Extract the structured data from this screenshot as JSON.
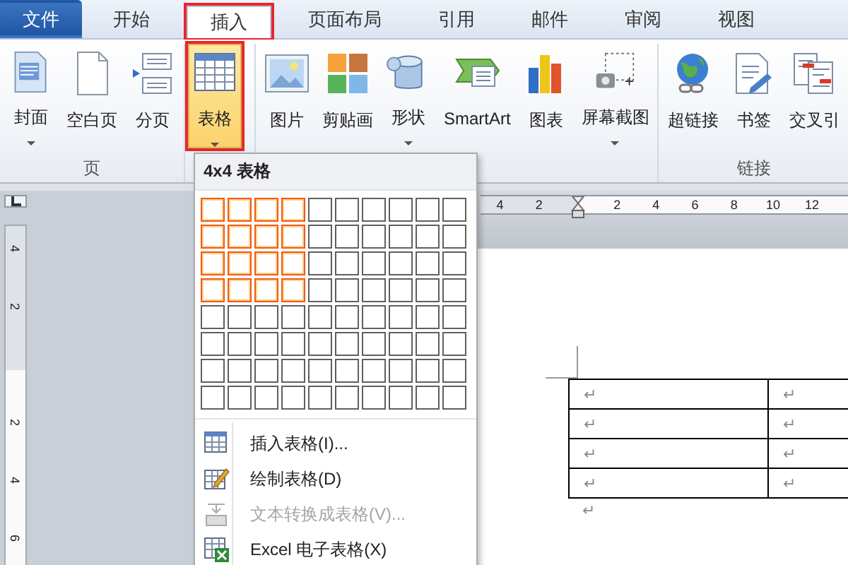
{
  "tabs": [
    {
      "label": "文件",
      "kind": "file",
      "selected": false,
      "marked": false
    },
    {
      "label": "开始",
      "kind": "tab",
      "selected": false,
      "marked": false
    },
    {
      "label": "插入",
      "kind": "tab",
      "selected": true,
      "marked": true
    },
    {
      "label": "页面布局",
      "kind": "tab",
      "selected": false,
      "marked": false
    },
    {
      "label": "引用",
      "kind": "tab",
      "selected": false,
      "marked": false
    },
    {
      "label": "邮件",
      "kind": "tab",
      "selected": false,
      "marked": false
    },
    {
      "label": "审阅",
      "kind": "tab",
      "selected": false,
      "marked": false
    },
    {
      "label": "视图",
      "kind": "tab",
      "selected": false,
      "marked": false
    }
  ],
  "ribbon": {
    "groups": [
      {
        "label": "页",
        "buttons": [
          {
            "label": "封面",
            "kind": "cover",
            "dropdown": true,
            "selected": false,
            "marked": false
          },
          {
            "label": "空白页",
            "kind": "blank",
            "dropdown": false,
            "selected": false,
            "marked": false
          },
          {
            "label": "分页",
            "kind": "pagebreak",
            "dropdown": false,
            "selected": false,
            "marked": false
          }
        ]
      },
      {
        "buttons": [
          {
            "label": "表格",
            "kind": "table",
            "dropdown": true,
            "selected": true,
            "marked": true
          }
        ]
      },
      {
        "buttons": [
          {
            "label": "图片",
            "kind": "picture",
            "dropdown": false,
            "selected": false,
            "marked": false
          },
          {
            "label": "剪贴画",
            "kind": "clipart",
            "dropdown": false,
            "selected": false,
            "marked": false
          },
          {
            "label": "形状",
            "kind": "shapes",
            "dropdown": true,
            "selected": false,
            "marked": false
          },
          {
            "label": "SmartArt",
            "kind": "smartart",
            "dropdown": false,
            "selected": false,
            "marked": false
          },
          {
            "label": "图表",
            "kind": "chart",
            "dropdown": false,
            "selected": false,
            "marked": false
          },
          {
            "label": "屏幕截图",
            "kind": "screenshot",
            "dropdown": true,
            "selected": false,
            "marked": false
          }
        ]
      },
      {
        "label": "链接",
        "buttons": [
          {
            "label": "超链接",
            "kind": "hyperlink",
            "dropdown": false,
            "selected": false,
            "marked": false
          },
          {
            "label": "书签",
            "kind": "bookmark",
            "dropdown": false,
            "selected": false,
            "marked": false
          },
          {
            "label": "交叉引",
            "kind": "crossref",
            "dropdown": false,
            "selected": false,
            "marked": false
          }
        ]
      }
    ]
  },
  "table_menu": {
    "title": "4x4 表格",
    "grid": [
      {
        "cells": [
          {
            "selected": true
          },
          {
            "selected": true
          },
          {
            "selected": true
          },
          {
            "selected": true
          },
          {
            "selected": false
          },
          {
            "selected": false
          },
          {
            "selected": false
          },
          {
            "selected": false
          },
          {
            "selected": false
          },
          {
            "selected": false
          }
        ]
      },
      {
        "cells": [
          {
            "selected": true
          },
          {
            "selected": true
          },
          {
            "selected": true
          },
          {
            "selected": true
          },
          {
            "selected": false
          },
          {
            "selected": false
          },
          {
            "selected": false
          },
          {
            "selected": false
          },
          {
            "selected": false
          },
          {
            "selected": false
          }
        ]
      },
      {
        "cells": [
          {
            "selected": true
          },
          {
            "selected": true
          },
          {
            "selected": true
          },
          {
            "selected": true
          },
          {
            "selected": false
          },
          {
            "selected": false
          },
          {
            "selected": false
          },
          {
            "selected": false
          },
          {
            "selected": false
          },
          {
            "selected": false
          }
        ]
      },
      {
        "cells": [
          {
            "selected": true
          },
          {
            "selected": true
          },
          {
            "selected": true
          },
          {
            "selected": true
          },
          {
            "selected": false
          },
          {
            "selected": false
          },
          {
            "selected": false
          },
          {
            "selected": false
          },
          {
            "selected": false
          },
          {
            "selected": false
          }
        ]
      },
      {
        "cells": [
          {
            "selected": false
          },
          {
            "selected": false
          },
          {
            "selected": false
          },
          {
            "selected": false
          },
          {
            "selected": false
          },
          {
            "selected": false
          },
          {
            "selected": false
          },
          {
            "selected": false
          },
          {
            "selected": false
          },
          {
            "selected": false
          }
        ]
      },
      {
        "cells": [
          {
            "selected": false
          },
          {
            "selected": false
          },
          {
            "selected": false
          },
          {
            "selected": false
          },
          {
            "selected": false
          },
          {
            "selected": false
          },
          {
            "selected": false
          },
          {
            "selected": false
          },
          {
            "selected": false
          },
          {
            "selected": false
          }
        ]
      },
      {
        "cells": [
          {
            "selected": false
          },
          {
            "selected": false
          },
          {
            "selected": false
          },
          {
            "selected": false
          },
          {
            "selected": false
          },
          {
            "selected": false
          },
          {
            "selected": false
          },
          {
            "selected": false
          },
          {
            "selected": false
          },
          {
            "selected": false
          }
        ]
      },
      {
        "cells": [
          {
            "selected": false
          },
          {
            "selected": false
          },
          {
            "selected": false
          },
          {
            "selected": false
          },
          {
            "selected": false
          },
          {
            "selected": false
          },
          {
            "selected": false
          },
          {
            "selected": false
          },
          {
            "selected": false
          },
          {
            "selected": false
          }
        ]
      }
    ],
    "items": [
      {
        "label": "插入表格(I)...",
        "kind": "insert",
        "disabled": false
      },
      {
        "label": "绘制表格(D)",
        "kind": "draw",
        "disabled": false
      },
      {
        "label": "文本转换成表格(V)...",
        "kind": "convert",
        "disabled": true
      },
      {
        "label": "Excel 电子表格(X)",
        "kind": "excel",
        "disabled": false
      }
    ]
  },
  "rulers": {
    "horizontal": [
      "4",
      "2",
      "2",
      "4",
      "6",
      "8",
      "10",
      "12"
    ],
    "vertical": [
      "4",
      "2",
      "2",
      "4",
      "6"
    ]
  },
  "document": {
    "table": {
      "rows": [
        [
          "↵",
          "↵"
        ],
        [
          "↵",
          "↵"
        ],
        [
          "↵",
          "↵"
        ],
        [
          "↵",
          "↵"
        ]
      ]
    },
    "paragraphs": [
      "↵"
    ]
  }
}
